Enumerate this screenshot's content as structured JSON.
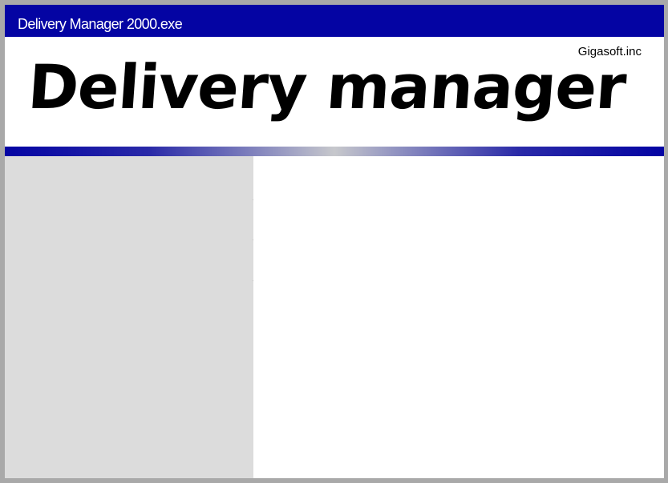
{
  "window": {
    "title": "Delivery Manager 2000.exe"
  },
  "header": {
    "company": "Gigasoft.inc",
    "app_title": "Delivery manager"
  },
  "colors": {
    "titlebar": "#0404a3",
    "sidebar": "#dcdcdc",
    "frame": "#a9a9a9"
  }
}
